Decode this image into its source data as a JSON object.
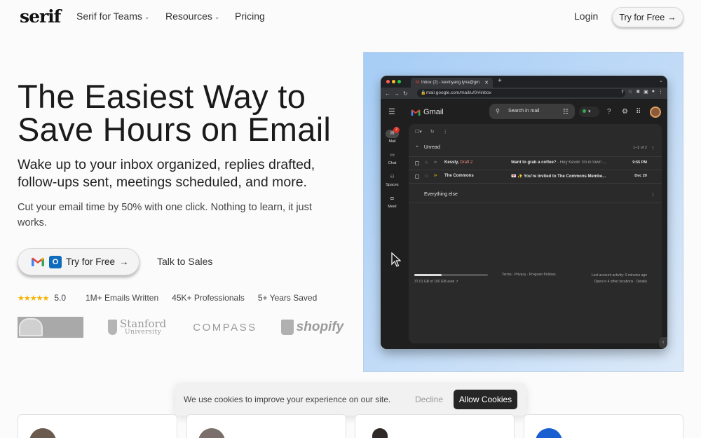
{
  "nav": {
    "logo": "serif",
    "links": [
      {
        "label": "Serif for Teams",
        "has_menu": true
      },
      {
        "label": "Resources",
        "has_menu": true
      },
      {
        "label": "Pricing",
        "has_menu": false
      }
    ],
    "login": "Login",
    "cta": "Try for Free",
    "arrow": "→",
    "chevron": "⌄"
  },
  "hero": {
    "title_line1": "The Easiest Way to",
    "title_line2": "Save Hours on Email",
    "subtitle_line1": "Wake up to your inbox organized, replies drafted,",
    "subtitle_line2": "follow-ups sent, meetings scheduled, and more.",
    "desc_line1": "Cut your email time by 50% with one click. Nothing to learn, it just",
    "desc_line2": "works.",
    "cta": "Try for Free",
    "cta_arrow": "→",
    "secondary": "Talk to Sales"
  },
  "stats": {
    "stars": "★★★★★",
    "rating": "5.0",
    "items": [
      "1M+ Emails Written",
      "45K+ Professionals",
      "5+ Years Saved"
    ]
  },
  "customer_logos": {
    "stanford_name": "Stanford",
    "stanford_sub": "University",
    "compass": "COMPASS",
    "shopify": "shopify"
  },
  "browser": {
    "tab_title": "Inbox (2) - kevinyang.lyna@gm",
    "url": "mail.google.com/mail/u/0/#inbox"
  },
  "gmail": {
    "app_name": "Gmail",
    "search_placeholder": "Search in mail",
    "rail": [
      {
        "label": "Mail",
        "badge": "2"
      },
      {
        "label": "Chat"
      },
      {
        "label": "Spaces"
      },
      {
        "label": "Meet"
      }
    ],
    "section_unread": "Unread",
    "count": "1–2 of 2",
    "emails": [
      {
        "from": "Kessly,",
        "draft": "Draft 2",
        "subject": "Want to grab a coffee?",
        "snippet": " - Hey Kevin! I'm in town ...",
        "time": "9:55 PM"
      },
      {
        "from": "The Commons",
        "draft": "",
        "subject": "💌 ✨ You're Invited to The Commons Membe...",
        "snippet": "",
        "time": "Dec 20"
      }
    ],
    "section_else": "Everything else",
    "quota_fraction": 0.37,
    "quota_text": "37.01 GB of 100 GB used",
    "footer_links": "Terms · Privacy · Program Policies",
    "activity_line1": "Last account activity: 0 minutes ago",
    "activity_line2": "Open in 4 other locations · Details"
  },
  "cookie": {
    "message": "We use cookies to improve your experience on our site.",
    "decline": "Decline",
    "allow": "Allow Cookies"
  },
  "colors": {
    "accent_dark": "#262626",
    "star": "#f5b400",
    "gmail_bg": "#1f1f1f",
    "frame_blue": "#a6cdf6",
    "draft_red": "#f28b82"
  }
}
